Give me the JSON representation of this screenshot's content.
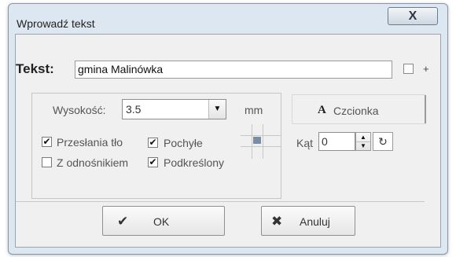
{
  "window": {
    "title": "Wprowadź tekst",
    "close_glyph": "X"
  },
  "tekst": {
    "label": "Tekst:",
    "value": "gmina Malinówka",
    "plus_label": "+"
  },
  "height": {
    "label": "Wysokość:",
    "value": "3.5",
    "unit": "mm"
  },
  "options": {
    "przeslania_to": {
      "label": "Przesłania tło",
      "checked": true
    },
    "pochyle": {
      "label": "Pochyłe",
      "checked": true
    },
    "z_odnosnikiem": {
      "label": "Z odnośnikiem",
      "checked": false
    },
    "podkreslony": {
      "label": "Podkreślony",
      "checked": true
    }
  },
  "font": {
    "icon_glyph": "A",
    "label": "Czcionka"
  },
  "angle": {
    "label": "Kąt",
    "value": "0"
  },
  "buttons": {
    "ok": "OK",
    "cancel": "Anuluj"
  },
  "icons": {
    "close": "close-icon",
    "check": "checkmark-icon",
    "cancel": "x-icon",
    "dropdown": "chevron-down-icon",
    "rotate": "rotate-icon"
  }
}
